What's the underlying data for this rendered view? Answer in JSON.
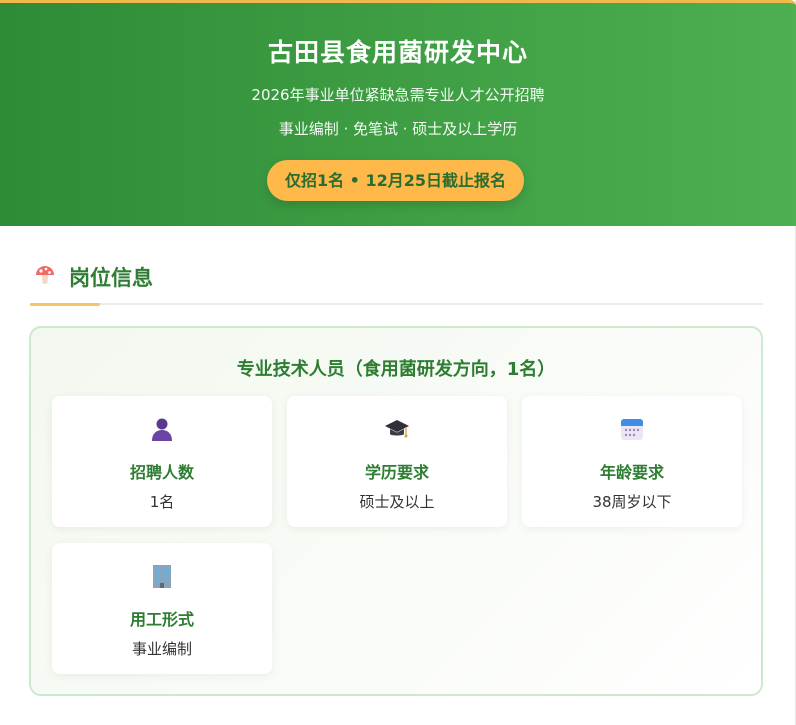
{
  "header": {
    "title": "古田县食用菌研发中心",
    "subtitle": "2026年事业单位紧缺急需专业人才公开招聘",
    "tags": "事业编制 · 免笔试 · 硕士及以上学历",
    "cta": "仅招1名 • 12月25日截止报名"
  },
  "section": {
    "title": "岗位信息",
    "icon": "mushroom-icon"
  },
  "position": {
    "title": "专业技术人员（食用菌研发方向，1名）",
    "cards": [
      {
        "icon": "person-icon",
        "label": "招聘人数",
        "value": "1名"
      },
      {
        "icon": "graduation-cap-icon",
        "label": "学历要求",
        "value": "硕士及以上"
      },
      {
        "icon": "calendar-icon",
        "label": "年龄要求",
        "value": "38周岁以下"
      },
      {
        "icon": "office-building-icon",
        "label": "用工形式",
        "value": "事业编制"
      }
    ]
  },
  "colors": {
    "header_green": "#3d9c42",
    "accent_orange": "#ffb84a",
    "text_green": "#2e7d32"
  }
}
